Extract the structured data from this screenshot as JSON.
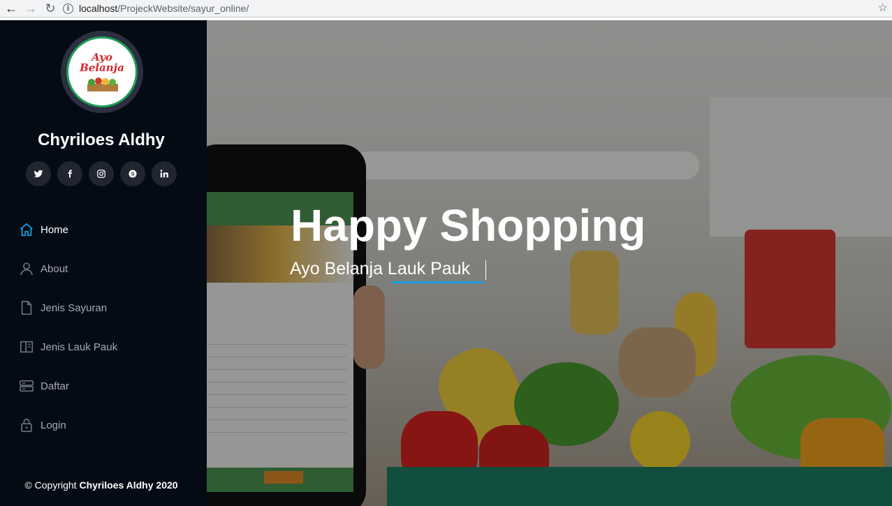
{
  "browser": {
    "url_host": "localhost",
    "url_path": "/ProjeckWebsite/sayur_online/"
  },
  "sidebar": {
    "logo_line1": "Ayo",
    "logo_line2": "Belanja",
    "owner_name": "Chyriloes Aldhy",
    "socials": [
      "twitter-icon",
      "facebook-icon",
      "instagram-icon",
      "skype-icon",
      "linkedin-icon"
    ],
    "menu": [
      {
        "label": "Home",
        "icon": "home-icon",
        "active": true
      },
      {
        "label": "About",
        "icon": "user-icon",
        "active": false
      },
      {
        "label": "Jenis Sayuran",
        "icon": "file-icon",
        "active": false
      },
      {
        "label": "Jenis Lauk Pauk",
        "icon": "book-icon",
        "active": false
      },
      {
        "label": "Daftar",
        "icon": "server-icon",
        "active": false
      },
      {
        "label": "Login",
        "icon": "lock-icon",
        "active": false
      }
    ],
    "copyright_prefix": "© Copyright",
    "copyright_name": "Chyriloes Aldhy 2020"
  },
  "hero": {
    "title": "Happy Shopping",
    "subtitle": "Ayo Belanja Lauk Pauk"
  },
  "colors": {
    "sidebar_bg": "#040b14",
    "accent": "#149ddd",
    "social_bg": "#212431"
  }
}
